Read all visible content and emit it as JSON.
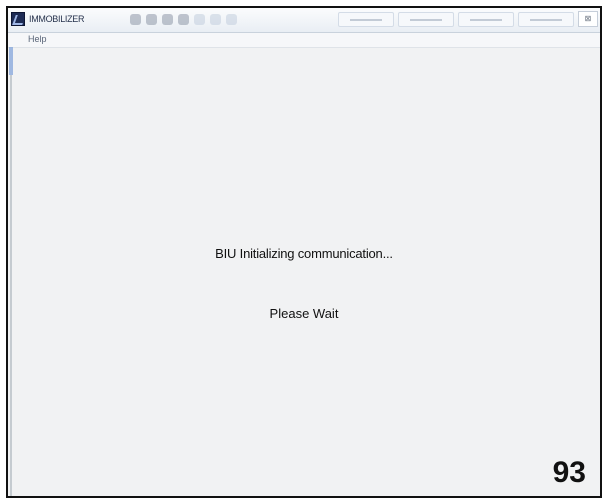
{
  "window": {
    "title": "IMMOBILIZER",
    "close_label": "⊠"
  },
  "toolbar": {
    "icons": [
      "toolbar-icon-1",
      "toolbar-icon-2",
      "toolbar-icon-3",
      "toolbar-icon-4",
      "toolbar-icon-5",
      "toolbar-icon-6",
      "toolbar-icon-7"
    ],
    "tabs_count_visual": 4
  },
  "menu": {
    "help_label": "Help"
  },
  "status": {
    "message": "BIU Initializing communication...",
    "wait": "Please Wait"
  },
  "page_number": "93",
  "colors": {
    "background": "#f1f2f3",
    "text": "#111111",
    "frame_border": "#111111"
  }
}
